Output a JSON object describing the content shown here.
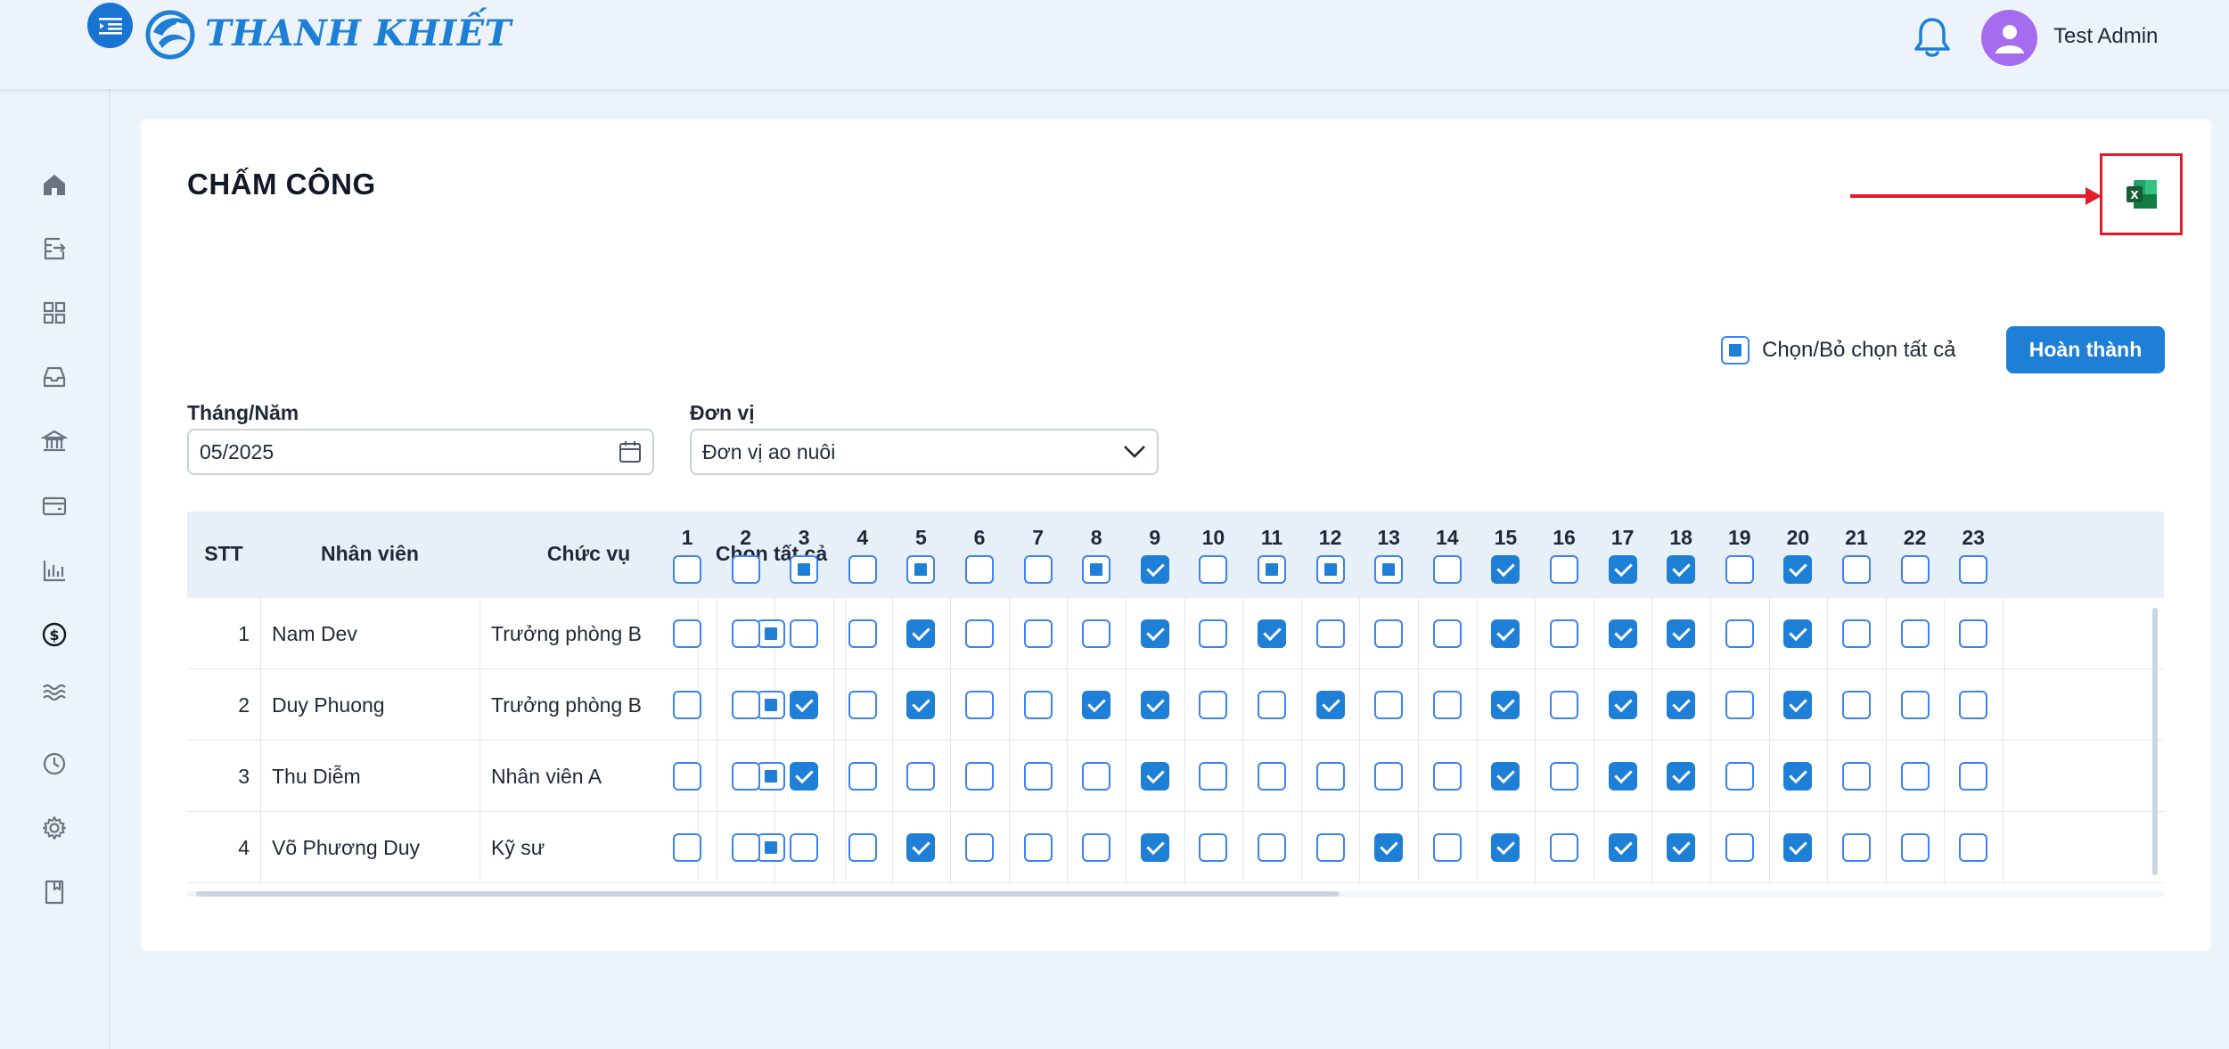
{
  "header": {
    "brand": "THANH KHIẾT",
    "user_name": "Test Admin"
  },
  "sidebar": {
    "items": [
      {
        "icon": "home-icon"
      },
      {
        "icon": "document-export-icon"
      },
      {
        "icon": "grid-icon"
      },
      {
        "icon": "inbox-icon"
      },
      {
        "icon": "bank-icon"
      },
      {
        "icon": "card-icon"
      },
      {
        "icon": "bar-chart-icon"
      },
      {
        "icon": "dollar-circle-icon"
      },
      {
        "icon": "waves-icon"
      },
      {
        "icon": "history-icon"
      },
      {
        "icon": "settings-icon"
      },
      {
        "icon": "book-icon"
      }
    ]
  },
  "page": {
    "title": "CHẤM CÔNG",
    "select_all_label": "Chọn/Bỏ chọn tất cả",
    "done_button": "Hoàn thành",
    "month_label": "Tháng/Năm",
    "month_value": "05/2025",
    "unit_label": "Đơn vị",
    "unit_value": "Đơn vị ao nuôi"
  },
  "table": {
    "headers": {
      "stt": "STT",
      "employee": "Nhân viên",
      "position": "Chức vụ",
      "select_all": "Chọn tất cả"
    },
    "days": [
      "1",
      "2",
      "3",
      "4",
      "5",
      "6",
      "7",
      "8",
      "9",
      "10",
      "11",
      "12",
      "13",
      "14",
      "15",
      "16",
      "17",
      "18",
      "19",
      "20",
      "21",
      "22",
      "23"
    ],
    "header_states": [
      "none",
      "none",
      "partial",
      "none",
      "partial",
      "none",
      "none",
      "partial",
      "checked",
      "none",
      "partial",
      "partial",
      "partial",
      "none",
      "checked",
      "none",
      "checked",
      "checked",
      "none",
      "checked",
      "none",
      "none",
      "none"
    ],
    "rows": [
      {
        "stt": "1",
        "name": "Nam Dev",
        "position": "Trưởng phòng B",
        "checked_days": [
          "5",
          "9",
          "11",
          "15",
          "17",
          "18",
          "20"
        ]
      },
      {
        "stt": "2",
        "name": "Duy Phuong",
        "position": "Trưởng phòng B",
        "checked_days": [
          "3",
          "5",
          "8",
          "9",
          "12",
          "15",
          "17",
          "18",
          "20"
        ]
      },
      {
        "stt": "3",
        "name": "Thu Diễm",
        "position": "Nhân viên A",
        "checked_days": [
          "3",
          "9",
          "15",
          "17",
          "18",
          "20"
        ]
      },
      {
        "stt": "4",
        "name": "Võ Phương Duy",
        "position": "Kỹ sư",
        "checked_days": [
          "5",
          "9",
          "13",
          "15",
          "17",
          "18",
          "20"
        ]
      }
    ]
  }
}
